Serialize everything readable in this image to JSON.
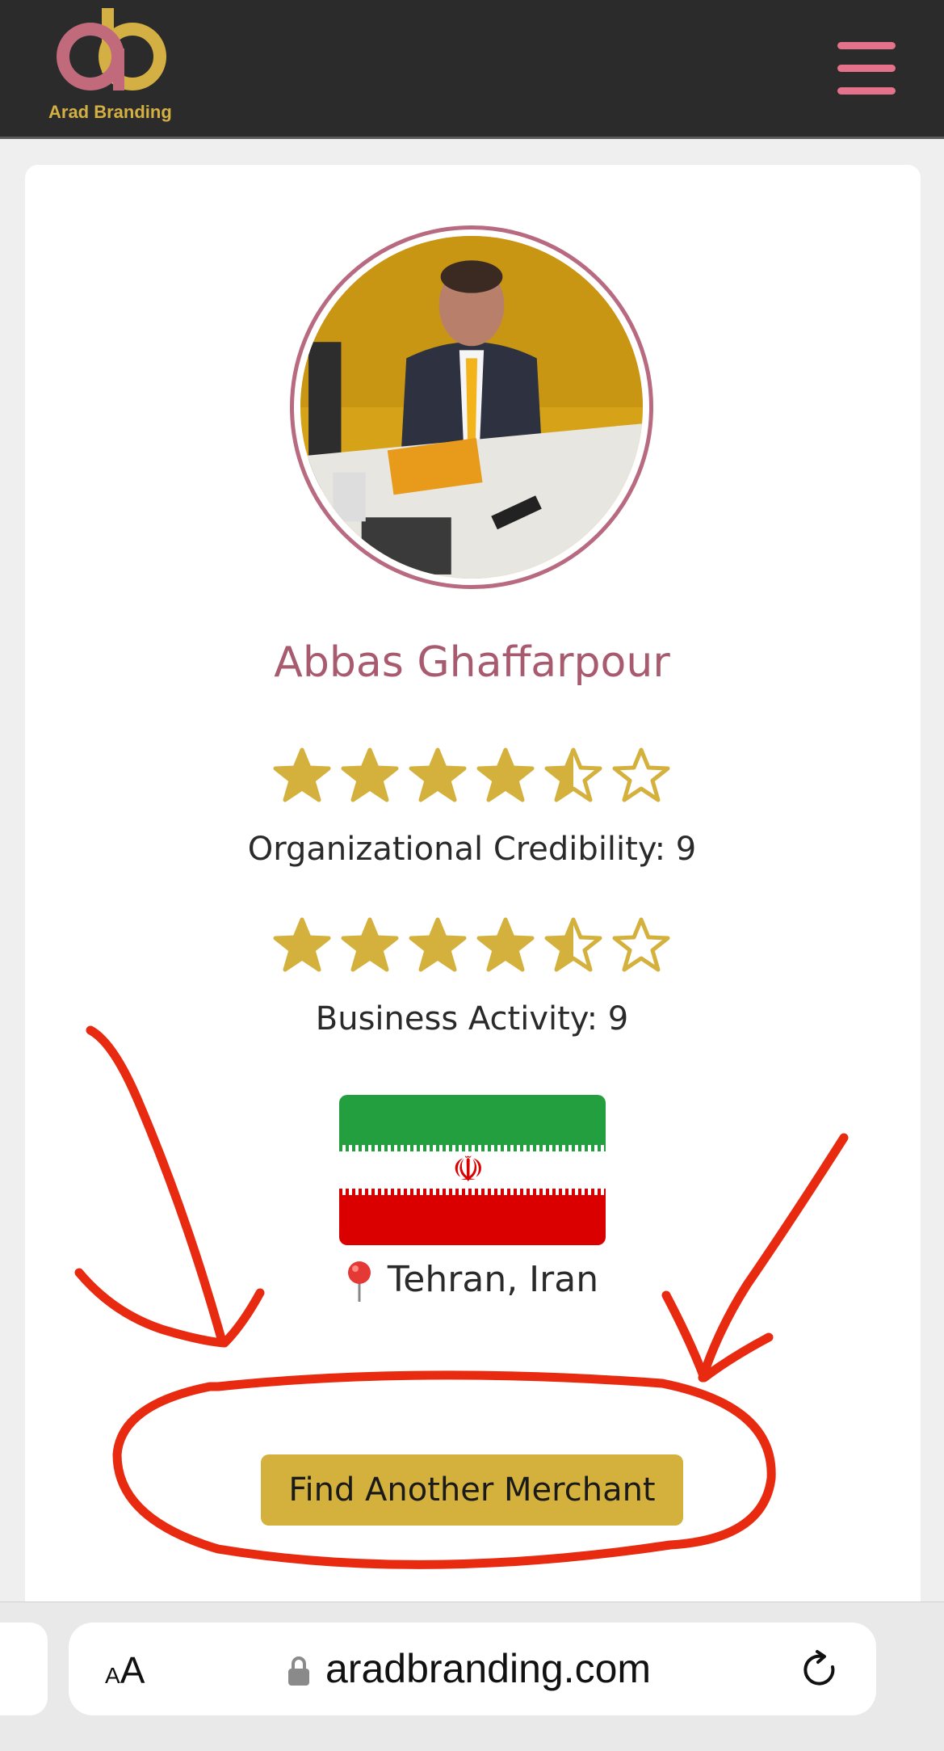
{
  "header": {
    "logo_text": "Arad Branding",
    "menu_icon": "hamburger-menu-icon",
    "accent_color": "#e3728a"
  },
  "profile": {
    "name": "Abbas Ghaffarpour",
    "name_color": "#a85a6e"
  },
  "ratings": [
    {
      "label": "Organizational Credibility: 9",
      "stars_filled": 4.5,
      "stars_total": 6
    },
    {
      "label": "Business Activity: 9",
      "stars_filled": 4.5,
      "stars_total": 6
    }
  ],
  "location": {
    "flag_icon": "iran-flag-icon",
    "pin_icon": "map-pin-icon",
    "text": "Tehran, Iran"
  },
  "cta": {
    "label": "Find Another Merchant",
    "color": "#d4b13c"
  },
  "browser": {
    "text_size_label_small": "A",
    "text_size_label_large": "A",
    "url": "aradbranding.com",
    "lock_icon": "lock-icon",
    "reload_icon": "reload-icon"
  }
}
